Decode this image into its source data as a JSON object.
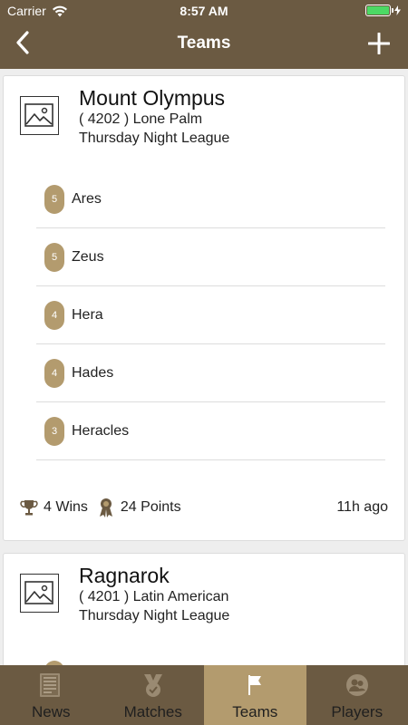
{
  "status_bar": {
    "carrier": "Carrier",
    "time": "8:57 AM"
  },
  "nav": {
    "title": "Teams",
    "back_icon": "chevron-left-icon",
    "add_icon": "plus-icon"
  },
  "teams": [
    {
      "name": "Mount Olympus",
      "location": "( 4202 ) Lone Palm",
      "league": "Thursday Night League",
      "players": [
        {
          "rank": "5",
          "name": "Ares"
        },
        {
          "rank": "5",
          "name": "Zeus"
        },
        {
          "rank": "4",
          "name": "Hera"
        },
        {
          "rank": "4",
          "name": "Hades"
        },
        {
          "rank": "3",
          "name": "Heracles"
        }
      ],
      "wins": "4 Wins",
      "points": "24 Points",
      "updated": "11h ago"
    },
    {
      "name": "Ragnarok",
      "location": "( 4201 ) Latin American",
      "league": "Thursday Night League"
    }
  ],
  "tabs": [
    {
      "label": "News",
      "icon": "newspaper-icon",
      "active": false
    },
    {
      "label": "Matches",
      "icon": "medal-icon",
      "active": false
    },
    {
      "label": "Teams",
      "icon": "flag-icon",
      "active": true
    },
    {
      "label": "Players",
      "icon": "players-icon",
      "active": false
    }
  ],
  "colors": {
    "header": "#6b5a42",
    "accent": "#b39b6e",
    "battery": "#4cd964"
  }
}
